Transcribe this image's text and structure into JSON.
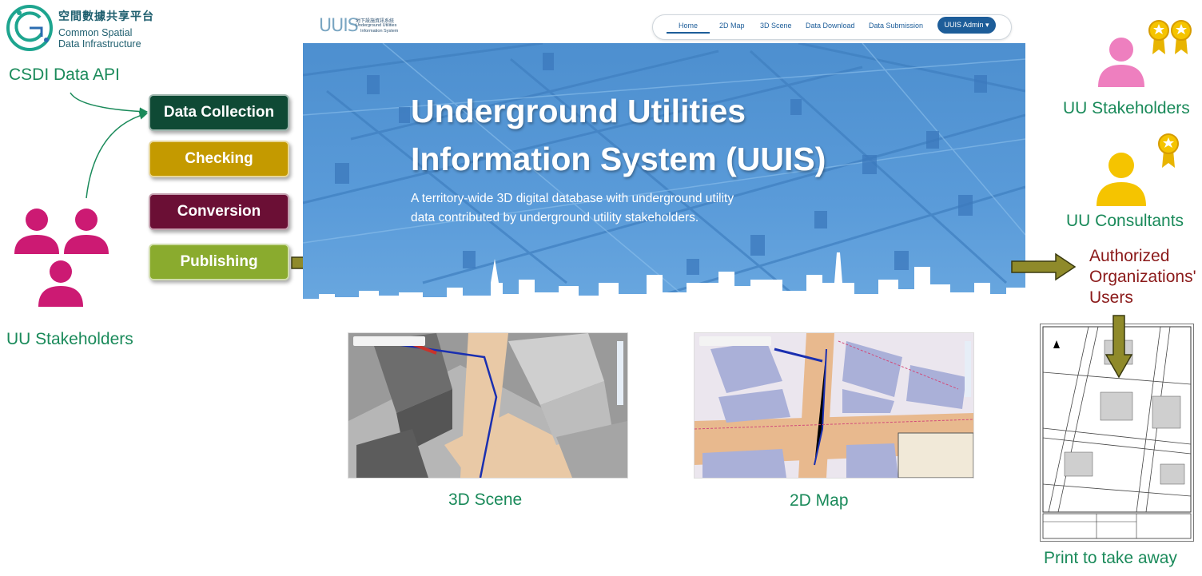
{
  "csdi": {
    "logo_name_zh": "空間數據共享平台",
    "logo_name_line1": "Common Spatial",
    "logo_name_line2": "Data Infrastructure",
    "api_label": "CSDI Data API"
  },
  "workflow": {
    "steps": [
      {
        "label": "Data Collection",
        "color": "#0f4a35"
      },
      {
        "label": "Checking",
        "color": "#c49a00"
      },
      {
        "label": "Conversion",
        "color": "#6b0f35"
      },
      {
        "label": "Publishing",
        "color": "#8aab2e"
      }
    ]
  },
  "left_stakeholders": {
    "label": "UU Stakeholders",
    "icon": "people-group-icon",
    "color": "#cc1a73"
  },
  "portal": {
    "logo_text": "UUIS",
    "logo_sub_zh": "地下設施資訊系統",
    "logo_sub_en1": "Underground Utilities",
    "logo_sub_en2": "Information System",
    "nav": [
      "Home",
      "2D Map",
      "3D Scene",
      "Data Download",
      "Data Submission"
    ],
    "admin_button": "UUIS Admin ▾",
    "hero_title_line1": "Underground Utilities",
    "hero_title_line2": "Information System (UUIS)",
    "hero_desc_line1": "A territory-wide 3D digital database with underground utility",
    "hero_desc_line2": "data contributed by underground utility stakeholders."
  },
  "views": {
    "scene3d_caption": "3D Scene",
    "map2d_caption": "2D Map"
  },
  "right": {
    "stakeholders_label": "UU Stakeholders",
    "consultants_label": "UU Consultants",
    "authorized_line1": "Authorized",
    "authorized_line2": "Organizations'",
    "authorized_line3": "Users",
    "print_label": "Print to take away"
  },
  "colors": {
    "green_text": "#1a8a5a",
    "maroon_text": "#8b1a1a",
    "arrow_fill": "#8f8a2a",
    "pink_person": "#ee7fbf",
    "yellow_person": "#f5c400",
    "hero_blue": "#5a9bd9"
  }
}
